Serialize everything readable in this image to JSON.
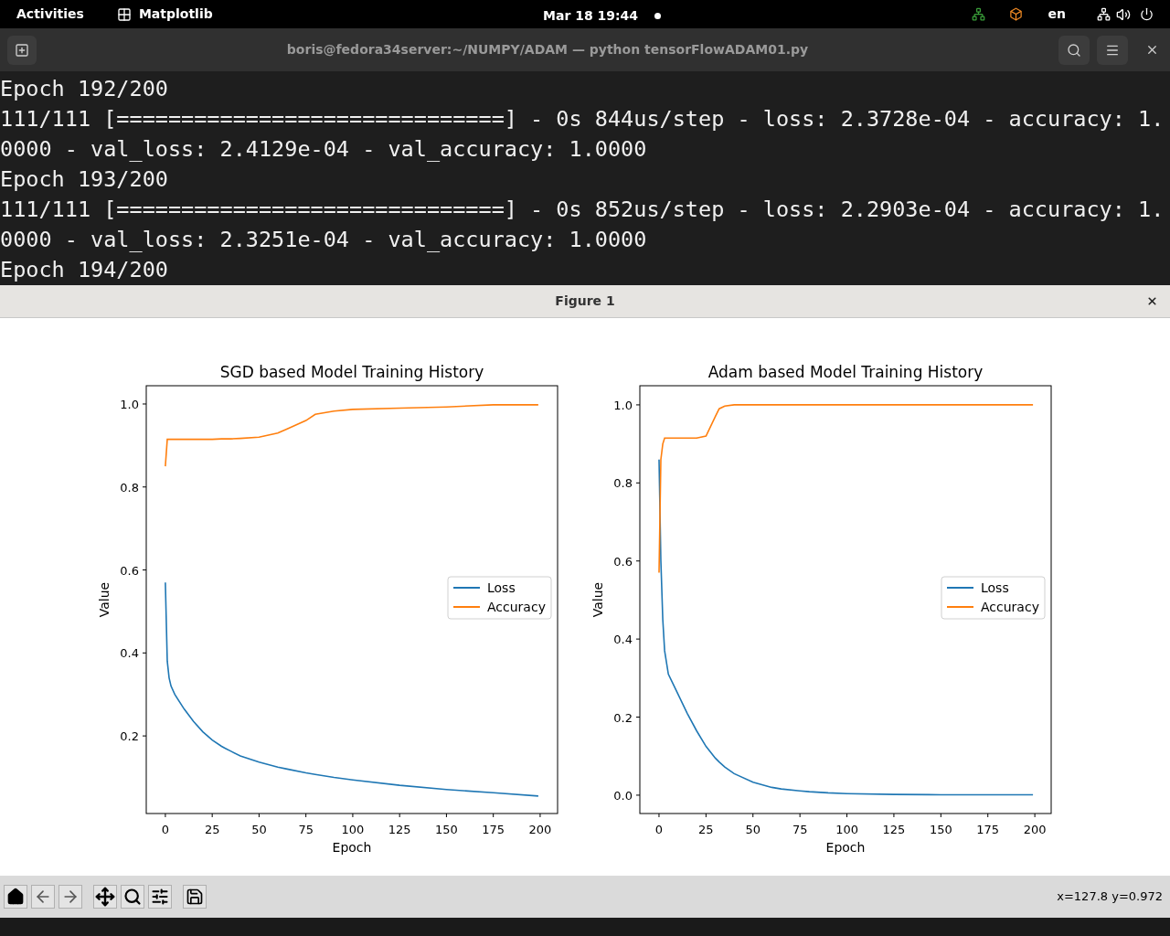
{
  "top_bar": {
    "activities": "Activities",
    "app_name": "Matplotlib",
    "clock": "Mar 18  19:44",
    "input_language": "en"
  },
  "terminal": {
    "title": "boris@fedora34server:~/NUMPY/ADAM — python tensorFlowADAM01.py",
    "lines": [
      "Epoch 192/200",
      "111/111 [==============================] - 0s 844us/step - loss: 2.3728e-04 - accuracy: 1.",
      "0000 - val_loss: 2.4129e-04 - val_accuracy: 1.0000",
      "Epoch 193/200",
      "111/111 [==============================] - 0s 852us/step - loss: 2.2903e-04 - accuracy: 1.",
      "0000 - val_loss: 2.3251e-04 - val_accuracy: 1.0000",
      "Epoch 194/200"
    ]
  },
  "figure": {
    "title": "Figure 1",
    "status": "x=127.8 y=0.972",
    "charts": [
      {
        "chart_data": {
          "type": "line",
          "title": "SGD based Model Training History",
          "xlabel": "Epoch",
          "ylabel": "Value",
          "x": [
            0,
            1,
            2,
            3,
            5,
            10,
            15,
            20,
            25,
            30,
            32,
            35,
            40,
            50,
            60,
            65,
            75,
            80,
            90,
            100,
            125,
            150,
            175,
            199
          ],
          "series": [
            {
              "name": "Loss",
              "color": "#1f77b4",
              "values": [
                0.57,
                0.38,
                0.34,
                0.32,
                0.3,
                0.265,
                0.235,
                0.21,
                0.19,
                0.175,
                0.17,
                0.163,
                0.152,
                0.137,
                0.125,
                0.12,
                0.111,
                0.107,
                0.1,
                0.094,
                0.081,
                0.071,
                0.063,
                0.055
              ]
            },
            {
              "name": "Accuracy",
              "color": "#ff7f0e",
              "values": [
                0.85,
                0.915,
                0.915,
                0.915,
                0.915,
                0.915,
                0.915,
                0.915,
                0.915,
                0.916,
                0.916,
                0.916,
                0.917,
                0.92,
                0.93,
                0.94,
                0.96,
                0.975,
                0.983,
                0.987,
                0.99,
                0.993,
                0.998,
                0.998
              ]
            }
          ],
          "legend": "center right",
          "xlim": [
            -10.2,
            209.3
          ],
          "ylim": [
            0.013,
            1.044
          ],
          "xticks": [
            0,
            25,
            50,
            75,
            100,
            125,
            150,
            175,
            200
          ],
          "yticks": [
            {
              "value": 0.2,
              "label": "0.2"
            },
            {
              "value": 0.4,
              "label": "0.4"
            },
            {
              "value": 0.6,
              "label": "0.6"
            },
            {
              "value": 0.8,
              "label": "0.8"
            },
            {
              "value": 1,
              "label": "1.0"
            }
          ]
        }
      },
      {
        "chart_data": {
          "type": "line",
          "title": "Adam based Model Training History",
          "xlabel": "Epoch",
          "ylabel": "Value",
          "x": [
            0,
            1,
            2,
            3,
            5,
            10,
            15,
            20,
            25,
            30,
            32,
            35,
            40,
            50,
            60,
            65,
            75,
            80,
            90,
            100,
            125,
            150,
            175,
            199
          ],
          "series": [
            {
              "name": "Loss",
              "color": "#1f77b4",
              "values": [
                0.86,
                0.6,
                0.45,
                0.37,
                0.31,
                0.26,
                0.21,
                0.165,
                0.125,
                0.095,
                0.085,
                0.072,
                0.055,
                0.033,
                0.02,
                0.016,
                0.011,
                0.009,
                0.006,
                0.004,
                0.002,
                0.001,
                0.001,
                0.001
              ]
            },
            {
              "name": "Accuracy",
              "color": "#ff7f0e",
              "values": [
                0.57,
                0.86,
                0.9,
                0.915,
                0.915,
                0.915,
                0.915,
                0.915,
                0.92,
                0.97,
                0.99,
                0.997,
                1,
                1,
                1,
                1,
                1,
                1,
                1,
                1,
                1,
                1,
                1,
                1
              ]
            }
          ],
          "legend": "center right",
          "xlim": [
            -10.2,
            208.7
          ],
          "ylim": [
            -0.047,
            1.049
          ],
          "xticks": [
            0,
            25,
            50,
            75,
            100,
            125,
            150,
            175,
            200
          ],
          "yticks": [
            {
              "value": 0,
              "label": "0.0"
            },
            {
              "value": 0.2,
              "label": "0.2"
            },
            {
              "value": 0.4,
              "label": "0.4"
            },
            {
              "value": 0.6,
              "label": "0.6"
            },
            {
              "value": 0.8,
              "label": "0.8"
            },
            {
              "value": 1,
              "label": "1.0"
            }
          ]
        }
      }
    ]
  }
}
